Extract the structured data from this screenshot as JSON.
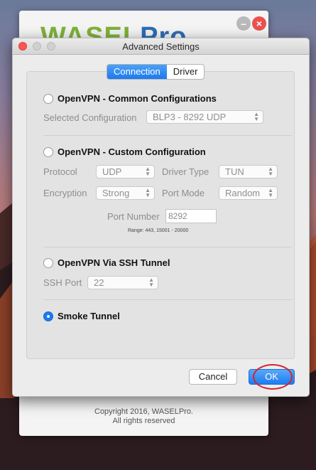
{
  "background_window": {
    "logo_main": "WASEL",
    "logo_accent": "Pro",
    "minimize_label": "–",
    "close_label": "×",
    "copyright_line1": "Copyright 2016, WASELPro.",
    "copyright_line2": "All rights reserved"
  },
  "dialog": {
    "title": "Advanced Settings",
    "tabs": [
      {
        "label": "Connection",
        "active": true
      },
      {
        "label": "Driver",
        "active": false
      }
    ],
    "common": {
      "label": "OpenVPN - Common Configurations",
      "selected_label": "Selected Configuration",
      "selected_value": "BLP3 - 8292 UDP"
    },
    "custom": {
      "label": "OpenVPN - Custom Configuration",
      "protocol_label": "Protocol",
      "protocol_value": "UDP",
      "driver_type_label": "Driver Type",
      "driver_type_value": "TUN",
      "encryption_label": "Encryption",
      "encryption_value": "Strong",
      "port_mode_label": "Port Mode",
      "port_mode_value": "Random",
      "port_number_label": "Port Number",
      "port_number_value": "8292",
      "range_text": "Range: 443, 15001 - 20000"
    },
    "ssh": {
      "label": "OpenVPN Via SSH Tunnel",
      "port_label": "SSH Port",
      "port_value": "22"
    },
    "smoke": {
      "label": "Smoke Tunnel",
      "selected": true
    },
    "cancel_label": "Cancel",
    "ok_label": "OK"
  }
}
